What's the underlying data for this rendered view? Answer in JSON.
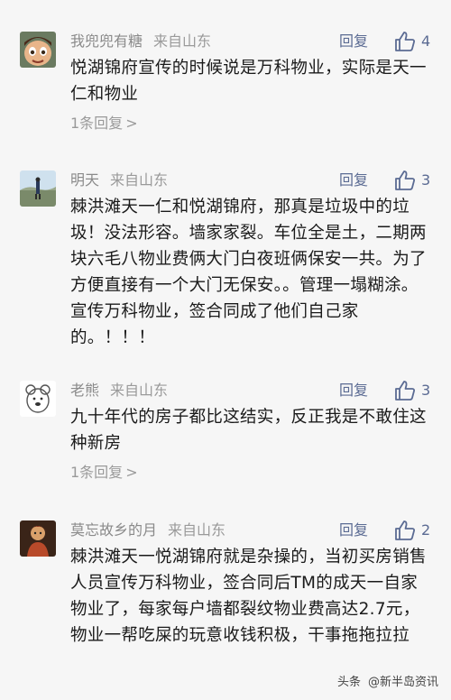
{
  "comments": [
    {
      "author": "我兜兜有糖",
      "location": "来自山东",
      "reply_label": "回复",
      "likes": "4",
      "text": "悦湖锦府宣传的时候说是万科物业，实际是天一仁和物业",
      "reply_count": "1条回复",
      "reply_chevron": ">"
    },
    {
      "author": "明天",
      "location": "来自山东",
      "reply_label": "回复",
      "likes": "3",
      "text": "棘洪滩天一仁和悦湖锦府，那真是垃圾中的垃圾！没法形容。墙家家裂。车位全是土，二期两块六毛八物业费俩大门白夜班俩保安一共。为了方便直接有一个大门无保安。。管理一塌糊涂。宣传万科物业，签合同成了他们自己家的。！！！"
    },
    {
      "author": "老熊",
      "location": "来自山东",
      "reply_label": "回复",
      "likes": "3",
      "text": "九十年代的房子都比这结实，反正我是不敢住这种新房",
      "reply_count": "1条回复",
      "reply_chevron": ">"
    },
    {
      "author": "莫忘故乡的月",
      "location": "来自山东",
      "reply_label": "回复",
      "likes": "2",
      "text": "棘洪滩天一悦湖锦府就是杂操的，当初买房销售人员宣传万科物业，签合同后TM的成天一自家物业了，每家每户墙都裂纹物业费高达2.7元，物业一帮吃屎的玩意收钱积极，干事拖拖拉拉"
    }
  ],
  "watermark": {
    "brand": "头条",
    "account": "@新半岛资讯"
  },
  "colors": {
    "background": "#f6f6f6",
    "accent": "#5b6b93",
    "meta": "#9a9a9a",
    "text": "#1a1a1a"
  },
  "icons": [
    "cartoon-boy-avatar",
    "landscape-person-avatar",
    "bear-sketch-avatar",
    "doll-figure-avatar",
    "thumbs-up-icon"
  ]
}
